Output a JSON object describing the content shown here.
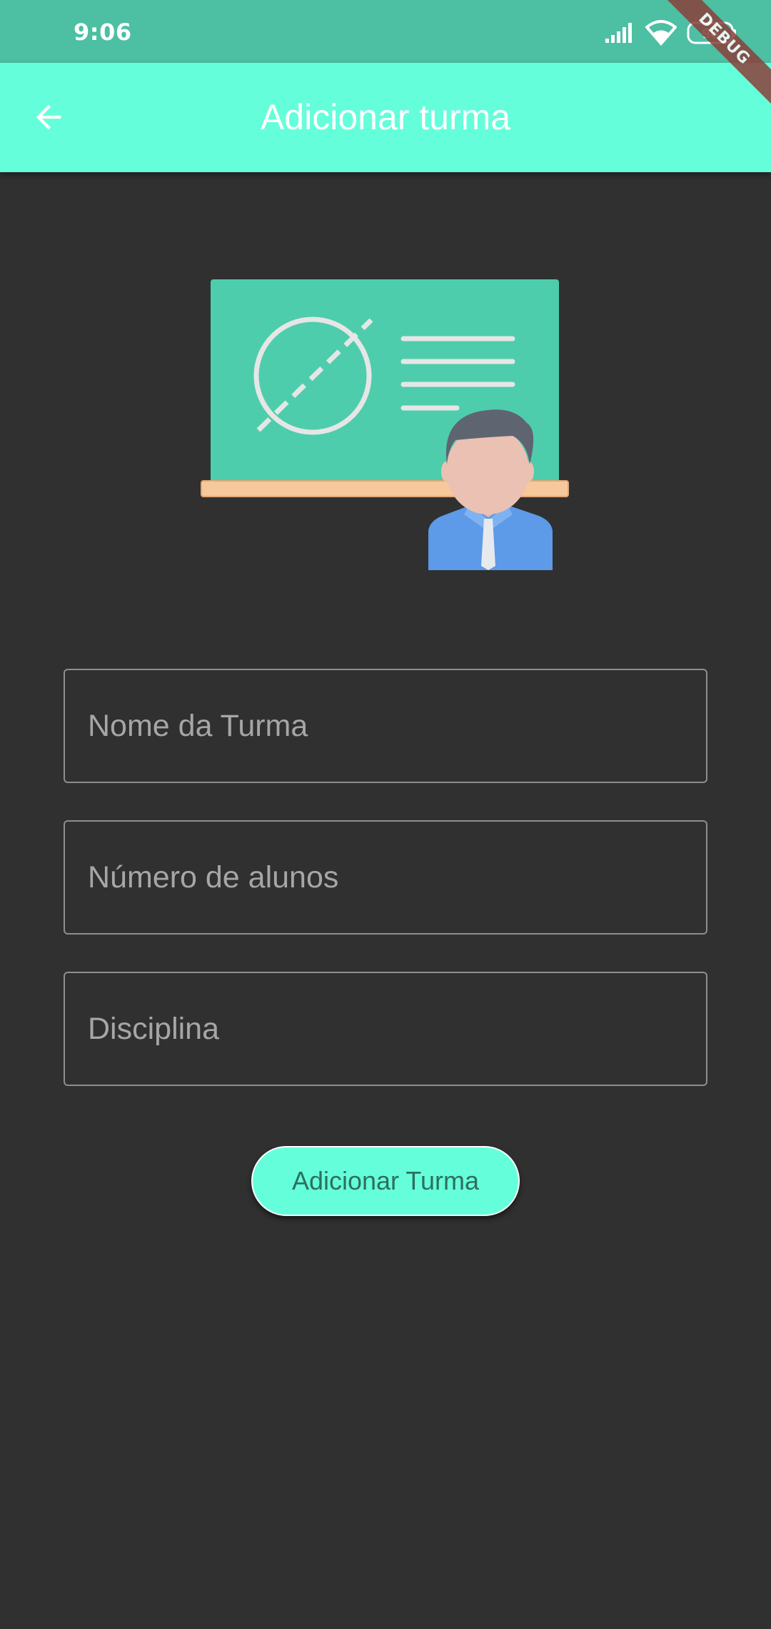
{
  "status_bar": {
    "time": "9:06",
    "icons": [
      "signal-icon",
      "wifi-icon",
      "battery-icon"
    ],
    "battery_level": "96"
  },
  "debug_banner": "DEBUG",
  "app_bar": {
    "title": "Adicionar turma",
    "back_icon": "arrow-back-icon"
  },
  "illustration": {
    "icon": "teacher-at-blackboard-icon"
  },
  "form": {
    "class_name": {
      "value": "",
      "placeholder": "Nome da Turma"
    },
    "student_count": {
      "value": "",
      "placeholder": "Número de alunos"
    },
    "subject": {
      "value": "",
      "placeholder": "Disciplina"
    }
  },
  "submit_label": "Adicionar Turma",
  "colors": {
    "status_bar": "#4dbfa3",
    "app_bar": "#64ffda",
    "background": "#303030",
    "button_text": "#2d6f5f"
  }
}
